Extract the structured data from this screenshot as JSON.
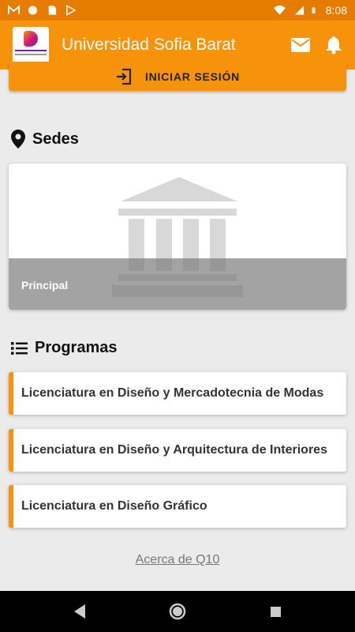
{
  "status_bar": {
    "time": "8:08",
    "left_icons": [
      "gmail-icon",
      "record-icon",
      "sd-card-icon",
      "play-store-icon"
    ],
    "right_icons": [
      "wifi-icon",
      "signal-icon",
      "battery-icon"
    ]
  },
  "app_bar": {
    "title": "Universidad Sofia Barat",
    "actions": [
      "mail-icon",
      "bell-icon"
    ]
  },
  "login": {
    "label": "INICIAR SESIÓN"
  },
  "sedes": {
    "title": "Sedes",
    "items": [
      {
        "name": "Principal"
      }
    ]
  },
  "programas": {
    "title": "Programas",
    "items": [
      {
        "label": "Licenciatura en Diseño y Mercadotecnia de Modas"
      },
      {
        "label": "Licenciatura en Diseño y Arquitectura de Interiores"
      },
      {
        "label": "Licenciatura en Diseño Gráfico"
      }
    ]
  },
  "footer": {
    "about_link": "Acerca de Q10"
  },
  "colors": {
    "primary": "#f7930a",
    "status_bar": "#e57c00",
    "background": "#ebebeb"
  }
}
